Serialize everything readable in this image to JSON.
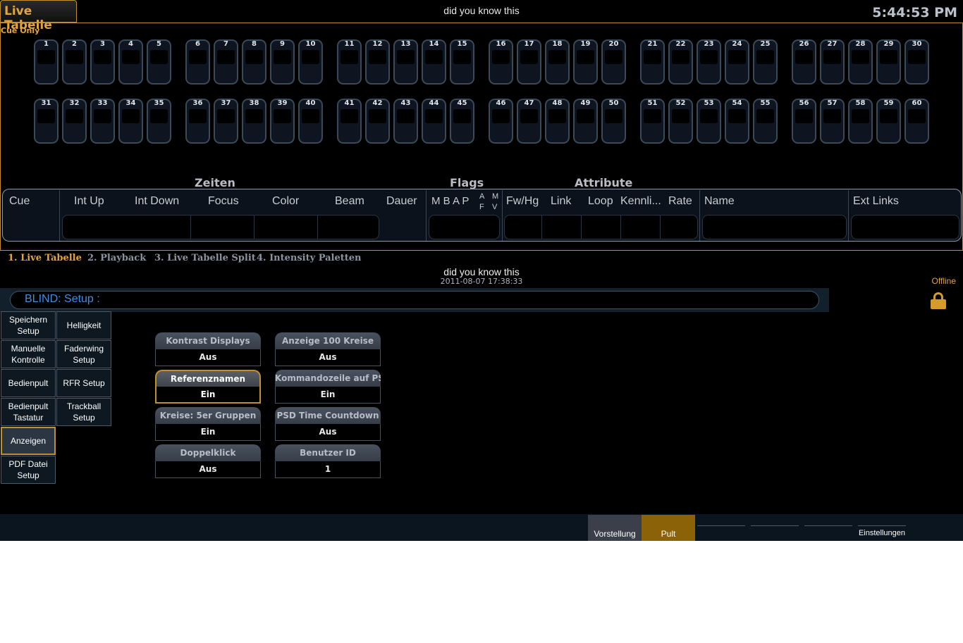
{
  "header": {
    "title_tab": "Live Tabelle",
    "center_title": "did you know this",
    "clock": "5:44:53 PM"
  },
  "cue_only": "Cue Only",
  "faders": [
    "1",
    "2",
    "3",
    "4",
    "5",
    "6",
    "7",
    "8",
    "9",
    "10",
    "11",
    "12",
    "13",
    "14",
    "15",
    "16",
    "17",
    "18",
    "19",
    "20",
    "21",
    "22",
    "23",
    "24",
    "25",
    "26",
    "27",
    "28",
    "29",
    "30",
    "31",
    "32",
    "33",
    "34",
    "35",
    "36",
    "37",
    "38",
    "39",
    "40",
    "41",
    "42",
    "43",
    "44",
    "45",
    "46",
    "47",
    "48",
    "49",
    "50",
    "51",
    "52",
    "53",
    "54",
    "55",
    "56",
    "57",
    "58",
    "59",
    "60"
  ],
  "sections": {
    "zeiten": "Zeiten",
    "flags": "Flags",
    "attribute": "Attribute"
  },
  "columns": {
    "cue": "Cue",
    "int_up": "Int Up",
    "int_down": "Int Down",
    "focus": "Focus",
    "color": "Color",
    "beam": "Beam",
    "dauer": "Dauer",
    "flags": "M B A P",
    "a": "A",
    "f": "F",
    "m": "M",
    "v": "V",
    "fw_hg": "Fw/Hg",
    "link": "Link",
    "loop": "Loop",
    "kennli": "Kennli...",
    "rate": "Rate",
    "name": "Name",
    "ext_links": "Ext Links"
  },
  "tabs": [
    "1. Live Tabelle",
    "2. Playback",
    "3. Live Tabelle Split",
    "4. Intensity Paletten"
  ],
  "lower": {
    "title": "did you know this",
    "date": "2011-08-07 17:38:33",
    "status": "Offline",
    "command_line": "BLIND: Setup :"
  },
  "side_buttons": [
    "Speichern\nSetup",
    "Helligkeit",
    "Manuelle\nKontrolle",
    "Faderwing\nSetup",
    "Bedienpult",
    "RFR Setup",
    "Bedienpult\nTastatur",
    "Trackball\nSetup",
    "Anzeigen",
    "PDF Datei\nSetup"
  ],
  "settings": [
    {
      "label": "Kontrast Displays",
      "value": "Aus"
    },
    {
      "label": "Anzeige 100 Kreise",
      "value": "Aus"
    },
    {
      "label": "Referenznamen",
      "value": "Ein"
    },
    {
      "label": "Kommandozeile auf PSD",
      "value": "Ein"
    },
    {
      "label": "Kreise: 5er Gruppen",
      "value": "Ein"
    },
    {
      "label": "PSD Time Countdown",
      "value": "Aus"
    },
    {
      "label": "Doppelklick",
      "value": "Aus"
    },
    {
      "label": "Benutzer ID",
      "value": "1"
    }
  ],
  "footer": {
    "vorstellung": "Vorstellung",
    "pult": "Pult",
    "einstellungen": "Einstellungen"
  },
  "colors": {
    "accent": "#e3a43c",
    "command": "#3c8fe6",
    "background": "#000000"
  },
  "icons": {
    "lock": "lock-icon"
  }
}
